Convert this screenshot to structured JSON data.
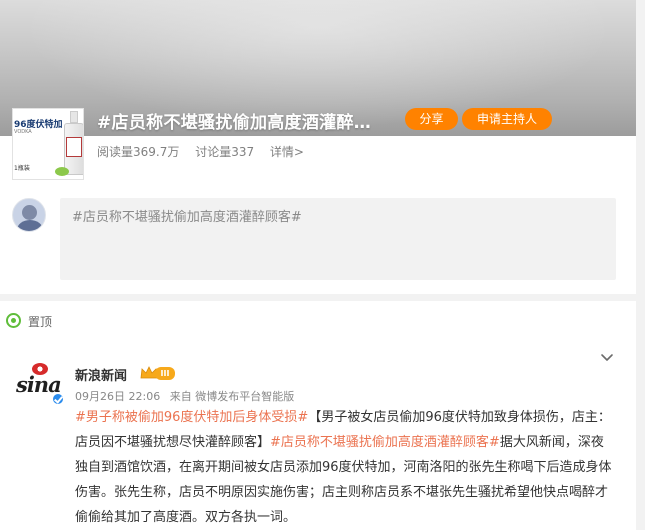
{
  "topic": {
    "title": "#店员称不堪骚扰偷加高度酒灌醉…",
    "share_label": "分享",
    "host_label": "申请主持人",
    "read_count": "阅读量369.7万",
    "discuss_count": "讨论量337",
    "detail_link": "详情>",
    "thumbnail": {
      "label_title": "96度伏特加",
      "label_sub": "VODKA",
      "label_bottom": "1瓶装"
    }
  },
  "composer": {
    "placeholder": "#店员称不堪骚扰偷加高度酒灌醉顾客#"
  },
  "feed": {
    "pinned_label": "置顶",
    "post": {
      "author": "新浪新闻",
      "logo_text": "sina",
      "vip_level": "III",
      "time": "09月26日 22:06",
      "source": "来自 微博发布平台智能版",
      "content": {
        "tag1": "#男子称被偷加96度伏特加后身体受损#",
        "text1": "【男子被女店员偷加96度伏特加致身体损伤，店主：店员因不堪骚扰想尽快灌醉顾客】",
        "tag2": "#店员称不堪骚扰偷加高度酒灌醉顾客#",
        "text2": "据大风新闻，深夜独自到酒馆饮酒，在离开期间被女店员添加96度伏特加，河南洛阳的张先生称喝下后造成身体伤害。张先生称，店员不明原因实施伤害；店主则称店员系不堪张先生骚扰希望他快点喝醉才偷偷给其加了高度酒。双方各执一词。"
      }
    }
  },
  "colors": {
    "accent_orange": "#ff8200",
    "tag_color": "#eb7350",
    "pin_green": "#5fbd3a",
    "verify_blue": "#2b8ced"
  },
  "icons": [
    "pin-icon",
    "chevron-down-icon",
    "crown-icon",
    "verified-icon"
  ]
}
